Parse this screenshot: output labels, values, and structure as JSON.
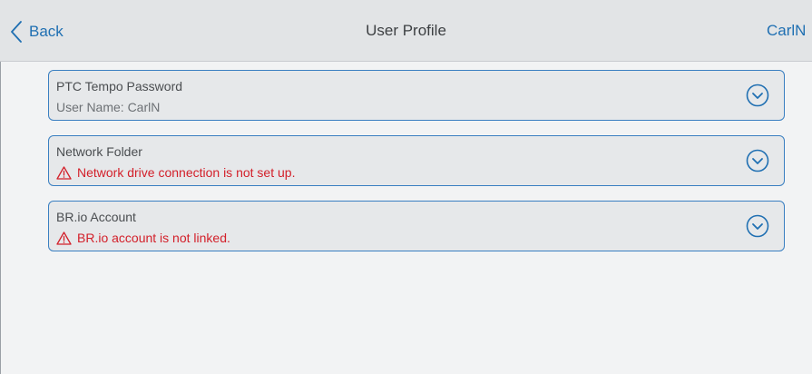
{
  "header": {
    "back_label": "Back",
    "title": "User Profile",
    "user_label": "CarlN"
  },
  "colors": {
    "accent": "#1f6fb2",
    "card_border": "#3a7fc1",
    "error": "#d3202a",
    "header_bg": "#e2e4e6",
    "page_bg": "#f2f3f4"
  },
  "cards": [
    {
      "title": "PTC Tempo Password",
      "subtitle": "User Name: CarlN",
      "status": "info",
      "icon": "chevron-down-circle-icon"
    },
    {
      "title": "Network Folder",
      "subtitle": "Network drive connection is not set up.",
      "status": "error",
      "icon": "chevron-down-circle-icon"
    },
    {
      "title": "BR.io Account",
      "subtitle": "BR.io account is not linked.",
      "status": "error",
      "icon": "chevron-down-circle-icon"
    }
  ]
}
